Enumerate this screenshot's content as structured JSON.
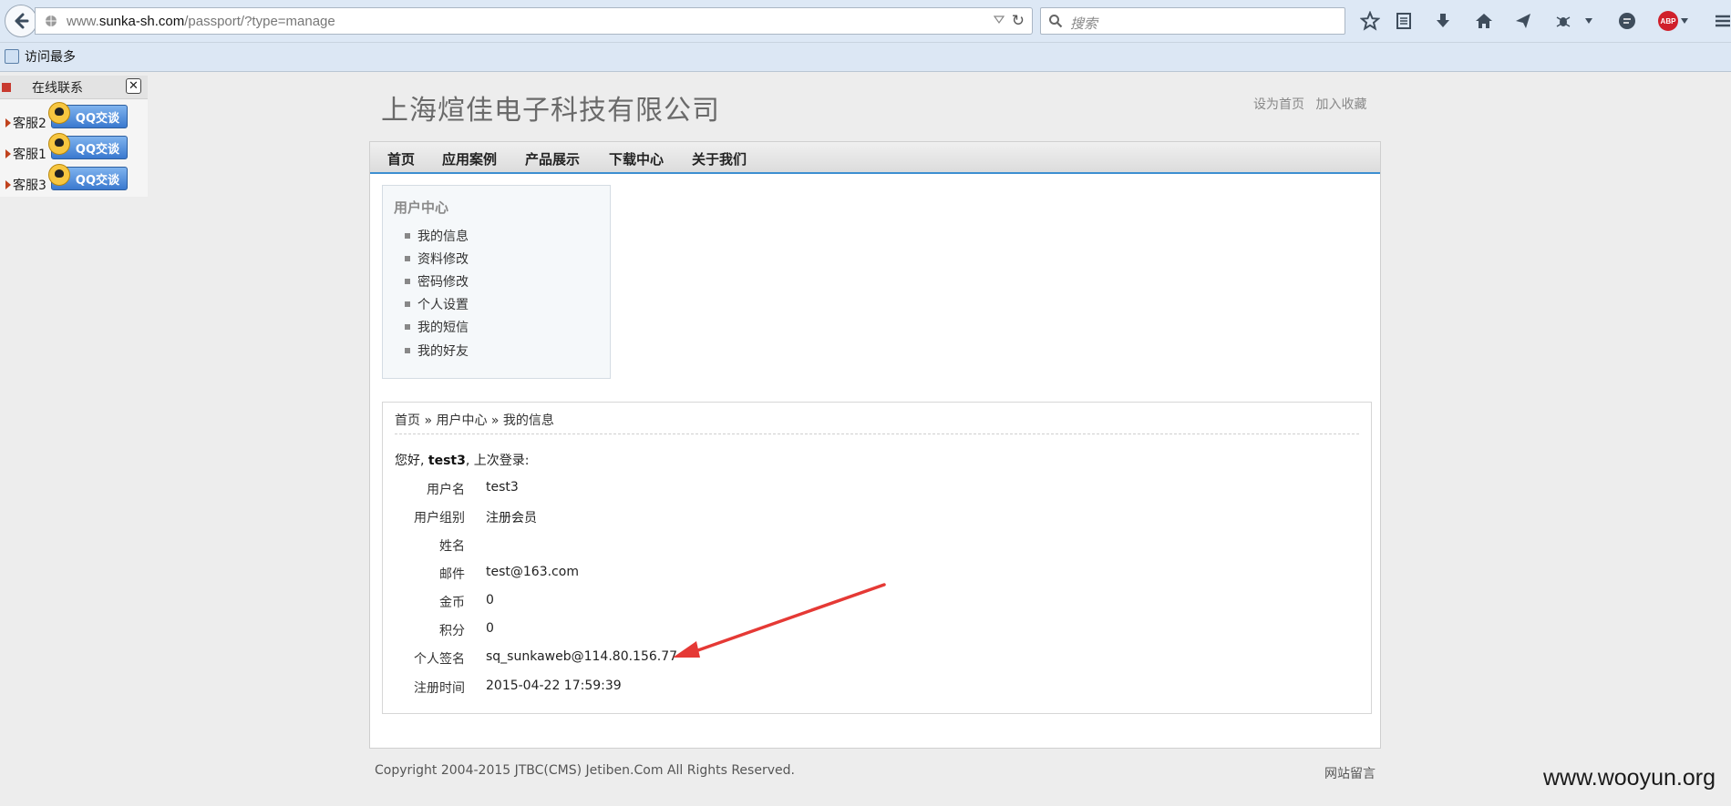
{
  "browser": {
    "url_domain_prefix": "www.",
    "url_domain": "sunka-sh.com",
    "url_path": "/passport/?type=manage",
    "search_placeholder": "搜索",
    "abp_label": "ABP",
    "bookmark_label": "访问最多"
  },
  "float_panel": {
    "title": "在线联系",
    "close_label": "✕",
    "items": [
      {
        "label": "客服2",
        "button": "QQ交谈"
      },
      {
        "label": "客服1",
        "button": "QQ交谈"
      },
      {
        "label": "客服3",
        "button": "QQ交谈"
      }
    ]
  },
  "site": {
    "company_name": "上海煊佳电子科技有限公司",
    "top_links": [
      "设为首页",
      "加入收藏"
    ],
    "nav": [
      "首页",
      "应用案例",
      "产品展示",
      "下载中心",
      "关于我们"
    ]
  },
  "sidebar": {
    "title": "用户中心",
    "items": [
      "我的信息",
      "资料修改",
      "密码修改",
      "个人设置",
      "我的短信",
      "我的好友"
    ]
  },
  "profile": {
    "breadcrumb": "首页 » 用户中心 » 我的信息",
    "greeting_prefix": "您好, ",
    "greeting_user": "test3",
    "greeting_suffix": ", 上次登录:",
    "fields": [
      {
        "label": "用户名",
        "value": "test3"
      },
      {
        "label": "用户组别",
        "value": "注册会员"
      },
      {
        "label": "姓名",
        "value": ""
      },
      {
        "label": "邮件",
        "value": "test@163.com"
      },
      {
        "label": "金币",
        "value": "0"
      },
      {
        "label": "积分",
        "value": "0"
      },
      {
        "label": "个人签名",
        "value": "sq_sunkaweb@114.80.156.77"
      },
      {
        "label": "注册时间",
        "value": "2015-04-22 17:59:39"
      }
    ]
  },
  "footer": {
    "copyright": "Copyright 2004-2015 JTBC(CMS) Jetiben.Com All Rights Reserved.",
    "guestbook": "网站留言"
  },
  "watermark": "www.wooyun.org",
  "colors": {
    "nav_accent": "#3d8fd1",
    "annotation_arrow": "#e53935",
    "qq_button": "#3a79cf"
  }
}
